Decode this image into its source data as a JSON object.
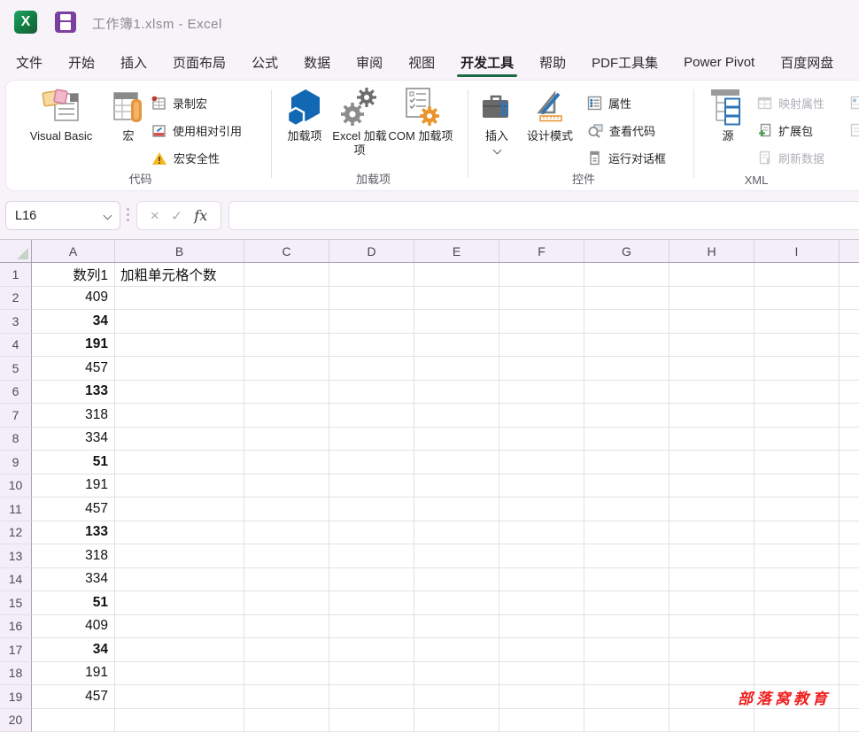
{
  "window": {
    "title": "工作簿1.xlsm  -  Excel"
  },
  "tabs": [
    {
      "name": "file",
      "label": "文件",
      "active": false
    },
    {
      "name": "home",
      "label": "开始",
      "active": false
    },
    {
      "name": "insert",
      "label": "插入",
      "active": false
    },
    {
      "name": "page-layout",
      "label": "页面布局",
      "active": false
    },
    {
      "name": "formulas",
      "label": "公式",
      "active": false
    },
    {
      "name": "data",
      "label": "数据",
      "active": false
    },
    {
      "name": "review",
      "label": "审阅",
      "active": false
    },
    {
      "name": "view",
      "label": "视图",
      "active": false
    },
    {
      "name": "developer",
      "label": "开发工具",
      "active": true
    },
    {
      "name": "help",
      "label": "帮助",
      "active": false
    },
    {
      "name": "pdf-tools",
      "label": "PDF工具集",
      "active": false
    },
    {
      "name": "power-pivot",
      "label": "Power Pivot",
      "active": false
    },
    {
      "name": "baidu-netdisk",
      "label": "百度网盘",
      "active": false
    }
  ],
  "ribbon": {
    "code_group": {
      "label": "代码",
      "visual_basic": "Visual Basic",
      "macros": "宏",
      "record_macro": "录制宏",
      "use_relative_references": "使用相对引用",
      "macro_security": "宏安全性"
    },
    "addins_group": {
      "label": "加载项",
      "addins": "加载项",
      "excel_addins": "Excel 加载项",
      "com_addins": "COM 加载项"
    },
    "controls_group": {
      "label": "控件",
      "insert": "插入",
      "design_mode": "设计模式",
      "properties": "属性",
      "view_code": "查看代码",
      "run_dialog": "运行对话框"
    },
    "xml_group": {
      "label": "XML",
      "source": "源",
      "map_properties": "映射属性",
      "expansion_packs": "扩展包",
      "refresh_data": "刷新数据"
    }
  },
  "formula_bar": {
    "name_box": "L16",
    "cancel": "×",
    "enter": "✓",
    "fx_label": "fx",
    "value": ""
  },
  "grid": {
    "columns": [
      "A",
      "B",
      "C",
      "D",
      "E",
      "F",
      "G",
      "H",
      "I"
    ],
    "column_widths": {
      "A": 94,
      "B": 146,
      "default": 96
    },
    "rows": [
      {
        "n": "1",
        "a": "数列1",
        "a_bold": false,
        "b": "加粗单元格个数"
      },
      {
        "n": "2",
        "a": "409",
        "a_bold": false,
        "b": ""
      },
      {
        "n": "3",
        "a": "34",
        "a_bold": true,
        "b": ""
      },
      {
        "n": "4",
        "a": "191",
        "a_bold": true,
        "b": ""
      },
      {
        "n": "5",
        "a": "457",
        "a_bold": false,
        "b": ""
      },
      {
        "n": "6",
        "a": "133",
        "a_bold": true,
        "b": ""
      },
      {
        "n": "7",
        "a": "318",
        "a_bold": false,
        "b": ""
      },
      {
        "n": "8",
        "a": "334",
        "a_bold": false,
        "b": ""
      },
      {
        "n": "9",
        "a": "51",
        "a_bold": true,
        "b": ""
      },
      {
        "n": "10",
        "a": "191",
        "a_bold": false,
        "b": ""
      },
      {
        "n": "11",
        "a": "457",
        "a_bold": false,
        "b": ""
      },
      {
        "n": "12",
        "a": "133",
        "a_bold": true,
        "b": ""
      },
      {
        "n": "13",
        "a": "318",
        "a_bold": false,
        "b": ""
      },
      {
        "n": "14",
        "a": "334",
        "a_bold": false,
        "b": ""
      },
      {
        "n": "15",
        "a": "51",
        "a_bold": true,
        "b": ""
      },
      {
        "n": "16",
        "a": "409",
        "a_bold": false,
        "b": ""
      },
      {
        "n": "17",
        "a": "34",
        "a_bold": true,
        "b": ""
      },
      {
        "n": "18",
        "a": "191",
        "a_bold": false,
        "b": ""
      },
      {
        "n": "19",
        "a": "457",
        "a_bold": false,
        "b": ""
      },
      {
        "n": "20",
        "a": "",
        "a_bold": false,
        "b": ""
      }
    ]
  },
  "watermark": {
    "text": "部落窝教育"
  },
  "colors": {
    "accent_green": "#1a6b43",
    "save_purple": "#7b3fa0",
    "addin_blue": "#1268b3",
    "gear_orange": "#e8952e",
    "warning_yellow": "#f7b824",
    "watermark_red": "#f01f1f",
    "header_bg": "#f3eef7"
  }
}
